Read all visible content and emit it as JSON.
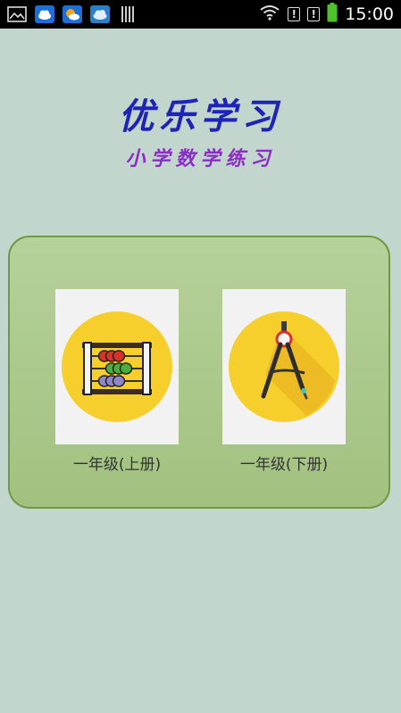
{
  "status_bar": {
    "time": "15:00",
    "alert_1": "!",
    "alert_2": "!",
    "icons": [
      "gallery-icon",
      "weather-cloud-icon",
      "weather-sun-icon",
      "cloud-icon",
      "barcode-icon",
      "wifi-icon",
      "battery-icon"
    ]
  },
  "header": {
    "title": "优乐学习",
    "subtitle": "小学数学练习"
  },
  "grades": [
    {
      "label": "一年级(上册)",
      "icon": "abacus-icon"
    },
    {
      "label": "一年级(下册)",
      "icon": "compass-icon"
    }
  ],
  "colors": {
    "background": "#c2d6cd",
    "title": "#1f24b8",
    "subtitle": "#8a2ec6",
    "panel": "#a9c78a",
    "icon_circle": "#f6cf2c"
  }
}
